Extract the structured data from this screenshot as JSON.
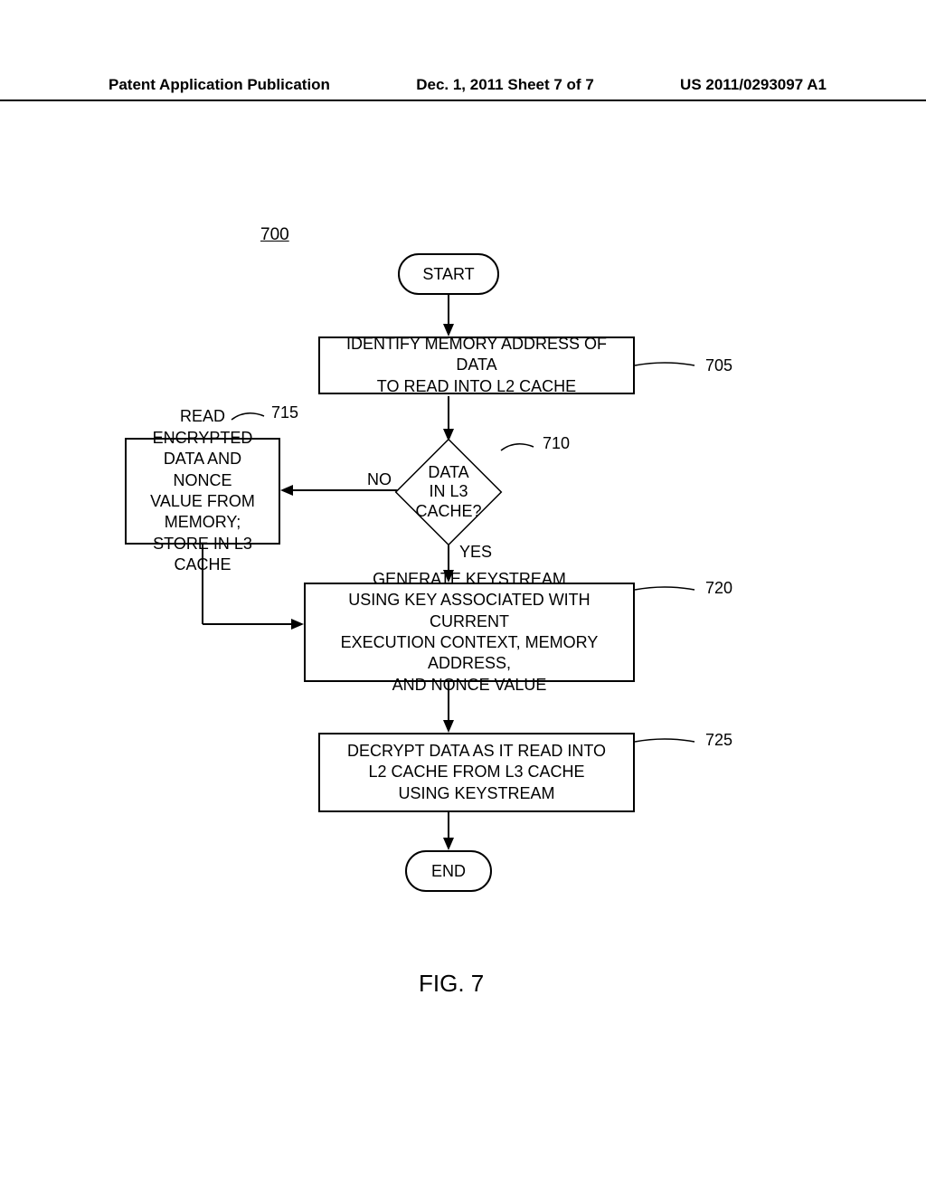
{
  "header": {
    "left": "Patent Application Publication",
    "center": "Dec. 1, 2011   Sheet 7 of 7",
    "right": "US 2011/0293097 A1"
  },
  "refNumber": "700",
  "start": {
    "label": "START"
  },
  "step705": {
    "text": "IDENTIFY MEMORY ADDRESS OF DATA\nTO READ INTO L2 CACHE",
    "ref": "705"
  },
  "decision710": {
    "text": "DATA\nIN L3 CACHE?",
    "ref": "710",
    "no": "NO",
    "yes": "YES"
  },
  "step715": {
    "text": "READ ENCRYPTED\nDATA AND NONCE\nVALUE FROM MEMORY;\nSTORE IN L3 CACHE",
    "ref": "715"
  },
  "step720": {
    "text": "GENERATE KEYSTREAM\nUSING KEY ASSOCIATED WITH CURRENT\nEXECUTION CONTEXT, MEMORY ADDRESS,\nAND NONCE VALUE",
    "ref": "720"
  },
  "step725": {
    "text": "DECRYPT DATA AS IT READ INTO\nL2 CACHE FROM L3 CACHE\nUSING KEYSTREAM",
    "ref": "725"
  },
  "end": {
    "label": "END"
  },
  "caption": "FIG. 7"
}
